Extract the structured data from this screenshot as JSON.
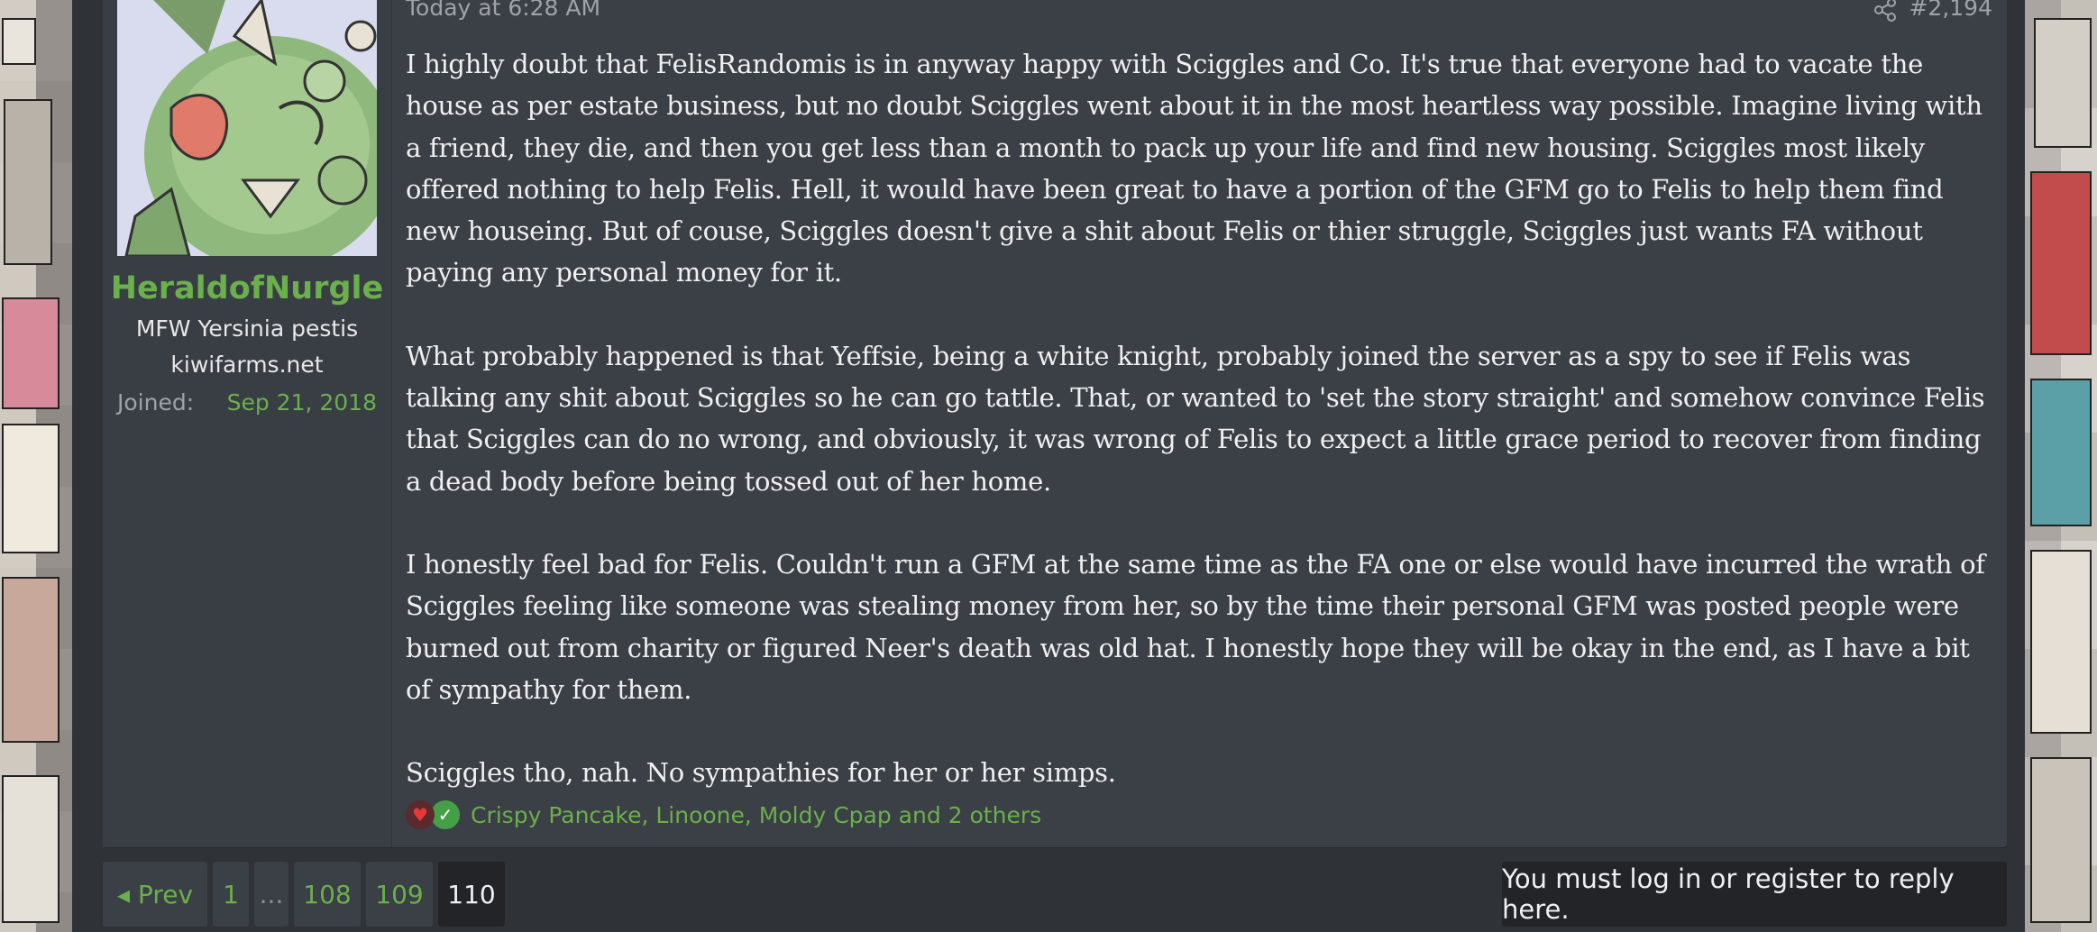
{
  "post": {
    "time": "Today at 6:28 AM",
    "number": "#2,194",
    "body": [
      "I highly doubt that FelisRandomis is in anyway happy with Sciggles and Co. It's true that everyone had to vacate the house as per estate business, but no doubt Sciggles went about it in the most heartless way possible. Imagine living with a friend, they die, and then you get less than a month to pack up your life and find new housing. Sciggles most likely offered nothing to help Felis. Hell, it would have been great to have a portion of the GFM go to Felis to help them find new houseing. But of couse, Sciggles doesn't give a shit about Felis or thier struggle, Sciggles just wants FA without paying any personal money for it.",
      "What probably happened is that Yeffsie, being a white knight, probably joined the server as a spy to see if Felis was talking any shit about Sciggles so he can go tattle. That, or wanted to 'set the story straight' and somehow convince Felis that Sciggles can do no wrong, and obviously, it was wrong of Felis to expect a little grace period to recover from finding a dead body before being tossed out of her home.",
      "I honestly feel bad for Felis. Couldn't run a GFM at the same time as the FA one or else would have incurred the wrath of Sciggles feeling like someone was stealing money from her, so by the time their personal GFM was posted people were burned out from charity or figured Neer's death was old hat. I honestly hope they will be okay in the end, as I have a bit of sympathy for them.",
      "Sciggles tho, nah. No sympathies for her or her simps."
    ],
    "reactions": {
      "icons": [
        "heart-icon",
        "check-icon"
      ],
      "text": "Crispy Pancake, Linoone, Moldy Cpap and 2 others"
    }
  },
  "user": {
    "name": "HeraldofNurgle",
    "title": "MFW Yersinia pestis",
    "domain": "kiwifarms.net",
    "joined_label": "Joined:",
    "joined_value": "Sep 21, 2018"
  },
  "pager": {
    "prev": "◂ Prev",
    "pages": [
      "1",
      "...",
      "108",
      "109",
      "110"
    ],
    "current": "110"
  },
  "login_notice": "You must log in or register to reply here.",
  "colors": {
    "accent_green": "#6ab04c",
    "post_bg": "#3b3f46",
    "page_bg": "#2f3237",
    "text": "#f0f0f0",
    "muted": "#9fa3a9"
  }
}
